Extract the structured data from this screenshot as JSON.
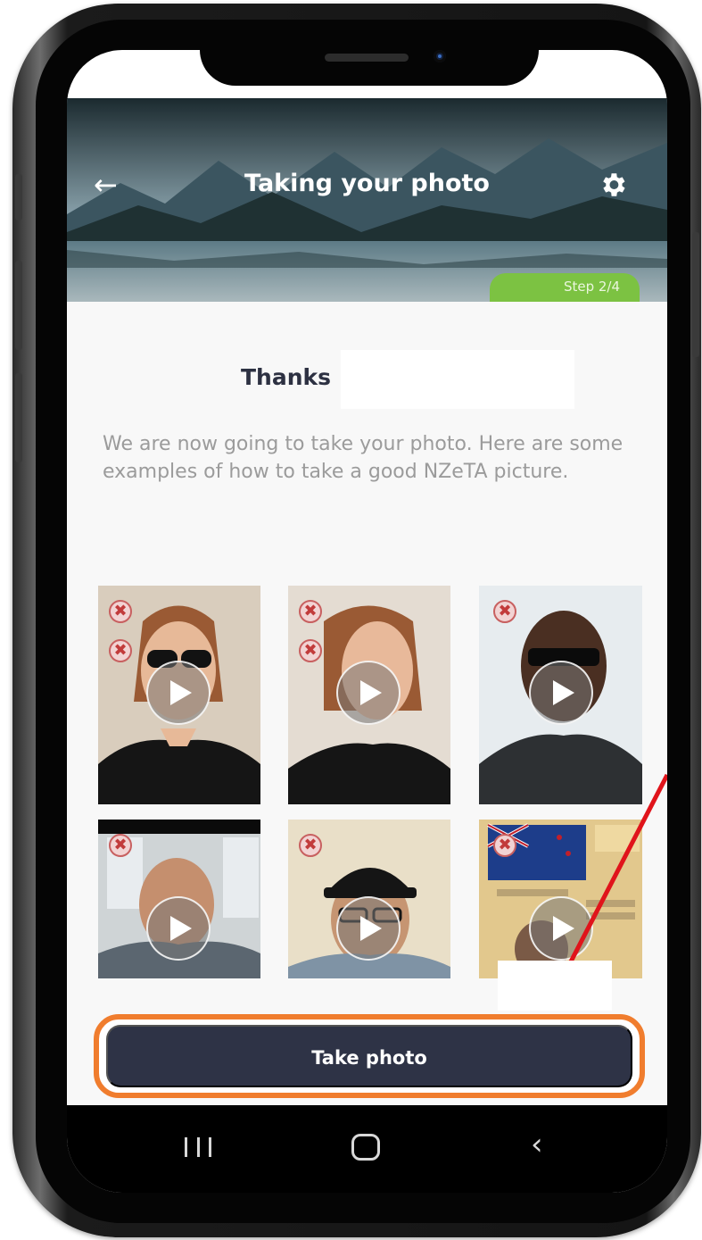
{
  "header": {
    "title": "Taking your photo",
    "back_icon": "arrow-left-icon",
    "settings_icon": "gear-icon",
    "step": "Step 2/4"
  },
  "main": {
    "thanks": "Thanks",
    "intro": "We are now going to take your photo. Here are some examples of how to take a good NZeTA picture.",
    "examples": [
      {
        "name": "example-sunglasses-woman",
        "rejects": 2
      },
      {
        "name": "example-turned-head-woman",
        "rejects": 2
      },
      {
        "name": "example-sunglasses-man",
        "rejects": 1
      },
      {
        "name": "example-busy-background-man",
        "rejects": 1
      },
      {
        "name": "example-hat-man",
        "rejects": 1
      },
      {
        "name": "example-id-card-photo",
        "rejects": 1
      }
    ],
    "take_photo_label": "Take photo"
  },
  "colors": {
    "primary_button": "#2e3346",
    "step_badge": "#7cc242",
    "highlight": "#f07d2e",
    "reject_icon": "#c23b3b"
  },
  "navbar": {
    "recent_icon": "recent-apps-icon",
    "home_icon": "home-icon",
    "back_icon": "chevron-left-icon"
  }
}
